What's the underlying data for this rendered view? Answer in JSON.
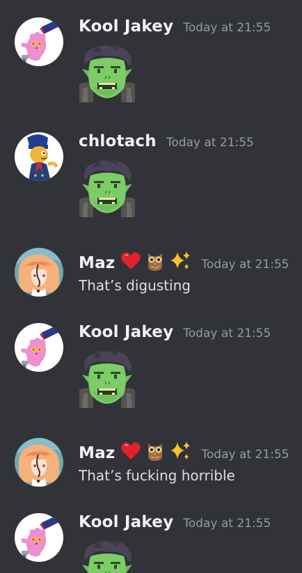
{
  "messages": [
    {
      "author": "Kool Jakey",
      "avatar": "pink-cat-avatar",
      "time": "Today at 21:55",
      "kind": "sticker",
      "sticker": "goblin-face-sticker"
    },
    {
      "author": "chlotach",
      "avatar": "cartoon-character-avatar",
      "time": "Today at 21:55",
      "kind": "sticker",
      "sticker": "goblin-face-sticker"
    },
    {
      "author": "Maz",
      "avatar": "orange-hair-avatar",
      "badges": [
        "❤️",
        "🦉",
        "✨"
      ],
      "time": "Today at 21:55",
      "kind": "text",
      "text": "That’s digusting"
    },
    {
      "author": "Kool Jakey",
      "avatar": "pink-cat-avatar",
      "time": "Today at 21:55",
      "kind": "sticker",
      "sticker": "goblin-face-sticker"
    },
    {
      "author": "Maz",
      "avatar": "orange-hair-avatar",
      "badges": [
        "❤️",
        "🦉",
        "✨"
      ],
      "time": "Today at 21:55",
      "kind": "text",
      "text": "That’s fucking horrible"
    },
    {
      "author": "Kool Jakey",
      "avatar": "pink-cat-avatar",
      "time": "Today at 21:55",
      "kind": "sticker",
      "sticker": "goblin-face-sticker"
    }
  ],
  "colors": {
    "background": "#313338",
    "username": "#f2f3f5",
    "timestamp": "#949ba4",
    "message_text": "#dbdee1"
  }
}
